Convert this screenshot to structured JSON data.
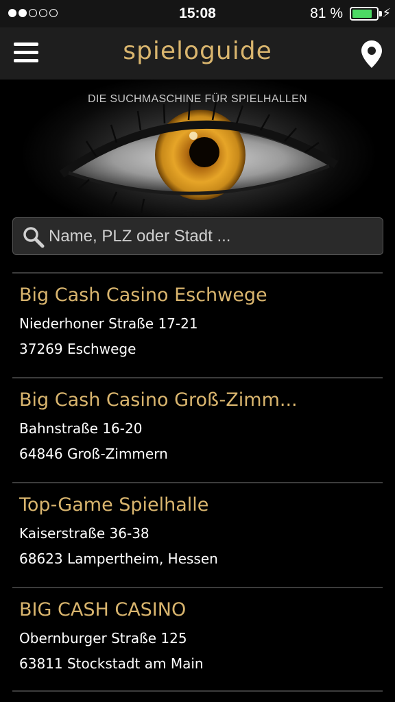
{
  "statusbar": {
    "time": "15:08",
    "battery_percent": "81 %",
    "battery_level": 0.81,
    "signal_bars_filled": 2,
    "signal_bars_total": 5
  },
  "header": {
    "title": "spieloguide",
    "menu_icon": "hamburger-icon",
    "location_icon": "location-pin-icon"
  },
  "hero": {
    "tagline": "DIE SUCHMASCHINE FÜR SPIELHALLEN"
  },
  "search": {
    "placeholder": "Name, PLZ oder Stadt ...",
    "value": ""
  },
  "results": [
    {
      "name": "Big Cash Casino Eschwege",
      "street": "Niederhoner Straße 17-21",
      "city": "37269 Eschwege"
    },
    {
      "name": "Big Cash Casino Groß-Zimm...",
      "street": "Bahnstraße 16-20",
      "city": "64846 Groß-Zimmern"
    },
    {
      "name": "Top-Game Spielhalle",
      "street": "Kaiserstraße 36-38",
      "city": "68623 Lampertheim, Hessen"
    },
    {
      "name": "BIG CASH CASINO",
      "street": "Obernburger Straße 125",
      "city": "63811 Stockstadt am Main"
    }
  ],
  "colors": {
    "accent_gold": "#d9b56e",
    "battery_green": "#4cd964",
    "background": "#000000"
  }
}
